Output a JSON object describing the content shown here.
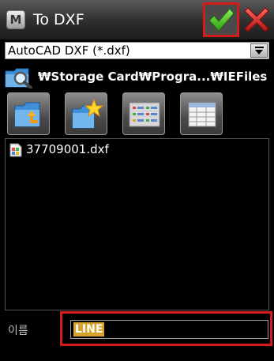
{
  "window": {
    "app_icon_letter": "M",
    "title": "To DXF",
    "ok_icon": "checkmark-icon",
    "cancel_icon": "close-icon"
  },
  "format": {
    "selected": "AutoCAD DXF (*.dxf)"
  },
  "path": {
    "icon": "folder-search-icon",
    "text": "₩Storage Card₩Progra...₩IEFiles"
  },
  "toolbar": [
    {
      "icon": "folder-up-icon"
    },
    {
      "icon": "new-folder-icon"
    },
    {
      "icon": "list-view-icon"
    },
    {
      "icon": "detail-view-icon"
    }
  ],
  "files": [
    {
      "icon": "dxf-file-icon",
      "name": "37709001.dxf"
    }
  ],
  "name_field": {
    "label": "이름",
    "value": "LINE"
  },
  "colors": {
    "highlight_border": "#d71a1a",
    "ok_green": "#3ab81e",
    "cancel_red": "#d41f1f",
    "selection": "#d7a32a"
  }
}
